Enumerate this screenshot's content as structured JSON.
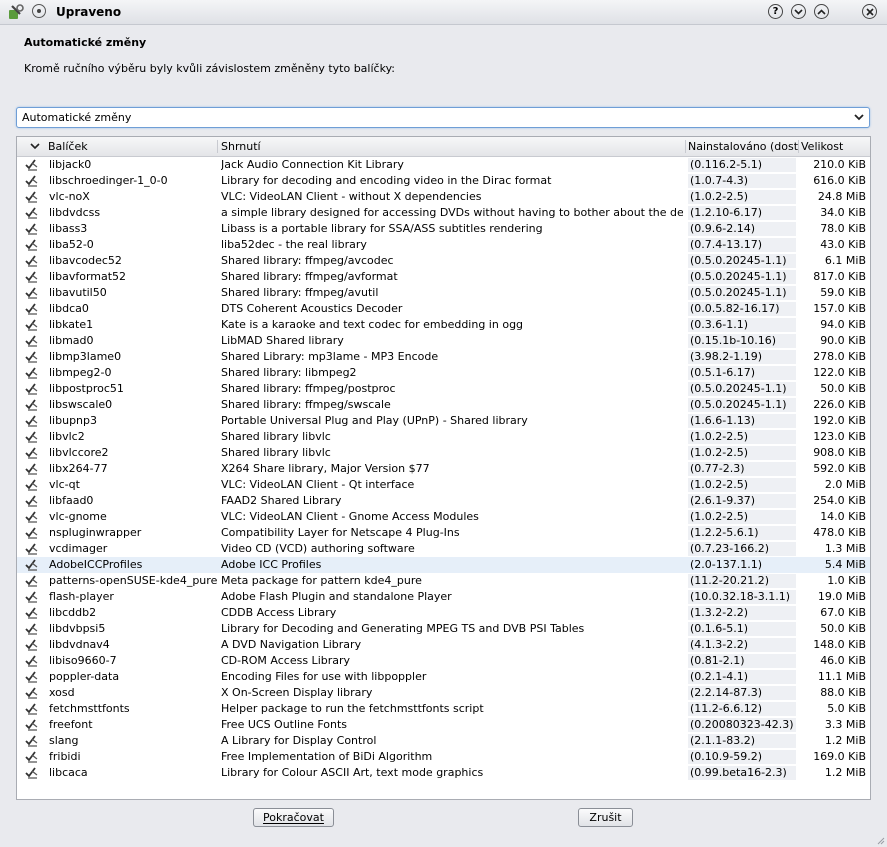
{
  "window": {
    "title": "Upraveno",
    "help_label": "?",
    "minimize_label": "⌄",
    "maximize_label": "⌃",
    "close_label": "✕"
  },
  "dialog": {
    "heading": "Automatické změny",
    "description": "Kromě ručního výběru byly kvůli závislostem změněny tyto balíčky:",
    "filter_selected": "Automatické změny"
  },
  "table": {
    "columns": [
      "Balíček",
      "Shrnutí",
      "Nainstalováno (dostup",
      "Velikost"
    ],
    "rows": [
      {
        "name": "libjack0",
        "summary": "Jack Audio Connection Kit Library",
        "installed": "(0.116.2-5.1)",
        "size": "210.0 KiB"
      },
      {
        "name": "libschroedinger-1_0-0",
        "summary": "Library for decoding and encoding video in the Dirac format",
        "installed": "(1.0.7-4.3)",
        "size": "616.0 KiB"
      },
      {
        "name": "vlc-noX",
        "summary": "VLC: VideoLAN Client - without X dependencies",
        "installed": "(1.0.2-2.5)",
        "size": "24.8 MiB"
      },
      {
        "name": "libdvdcss",
        "summary": "a simple library designed for accessing DVDs without having to bother about the decryption.",
        "installed": "(1.2.10-6.17)",
        "size": "34.0 KiB"
      },
      {
        "name": "libass3",
        "summary": "Libass is a portable library for SSA/ASS subtitles rendering",
        "installed": "(0.9.6-2.14)",
        "size": "78.0 KiB"
      },
      {
        "name": "liba52-0",
        "summary": "liba52dec - the real library",
        "installed": "(0.7.4-13.17)",
        "size": "43.0 KiB"
      },
      {
        "name": "libavcodec52",
        "summary": "Shared library: ffmpeg/avcodec",
        "installed": "(0.5.0.20245-1.1)",
        "size": "6.1 MiB"
      },
      {
        "name": "libavformat52",
        "summary": "Shared library: ffmpeg/avformat",
        "installed": "(0.5.0.20245-1.1)",
        "size": "817.0 KiB"
      },
      {
        "name": "libavutil50",
        "summary": "Shared library: ffmpeg/avutil",
        "installed": "(0.5.0.20245-1.1)",
        "size": "59.0 KiB"
      },
      {
        "name": "libdca0",
        "summary": "DTS Coherent Acoustics Decoder",
        "installed": "(0.0.5.82-16.17)",
        "size": "157.0 KiB"
      },
      {
        "name": "libkate1",
        "summary": "Kate is a karaoke and text codec for embedding in ogg",
        "installed": "(0.3.6-1.1)",
        "size": "94.0 KiB"
      },
      {
        "name": "libmad0",
        "summary": "LibMAD Shared library",
        "installed": "(0.15.1b-10.16)",
        "size": "90.0 KiB"
      },
      {
        "name": "libmp3lame0",
        "summary": "Shared Library: mp3lame - MP3 Encode",
        "installed": "(3.98.2-1.19)",
        "size": "278.0 KiB"
      },
      {
        "name": "libmpeg2-0",
        "summary": "Shared library: libmpeg2",
        "installed": "(0.5.1-6.17)",
        "size": "122.0 KiB"
      },
      {
        "name": "libpostproc51",
        "summary": "Shared library: ffmpeg/postproc",
        "installed": "(0.5.0.20245-1.1)",
        "size": "50.0 KiB"
      },
      {
        "name": "libswscale0",
        "summary": "Shared library: ffmpeg/swscale",
        "installed": "(0.5.0.20245-1.1)",
        "size": "226.0 KiB"
      },
      {
        "name": "libupnp3",
        "summary": "Portable Universal Plug and Play (UPnP) - Shared library",
        "installed": "(1.6.6-1.13)",
        "size": "192.0 KiB"
      },
      {
        "name": "libvlc2",
        "summary": "Shared library libvlc",
        "installed": "(1.0.2-2.5)",
        "size": "123.0 KiB"
      },
      {
        "name": "libvlccore2",
        "summary": "Shared library libvlc",
        "installed": "(1.0.2-2.5)",
        "size": "908.0 KiB"
      },
      {
        "name": "libx264-77",
        "summary": "X264 Share library, Major Version $77",
        "installed": "(0.77-2.3)",
        "size": "592.0 KiB"
      },
      {
        "name": "vlc-qt",
        "summary": "VLC: VideoLAN Client - Qt interface",
        "installed": "(1.0.2-2.5)",
        "size": "2.0 MiB"
      },
      {
        "name": "libfaad0",
        "summary": "FAAD2 Shared Library",
        "installed": "(2.6.1-9.37)",
        "size": "254.0 KiB"
      },
      {
        "name": "vlc-gnome",
        "summary": "VLC: VideoLAN Client - Gnome Access Modules",
        "installed": "(1.0.2-2.5)",
        "size": "14.0 KiB"
      },
      {
        "name": "nspluginwrapper",
        "summary": "Compatibility Layer for Netscape 4 Plug-Ins",
        "installed": "(1.2.2-5.6.1)",
        "size": "478.0 KiB"
      },
      {
        "name": "vcdimager",
        "summary": "Video CD (VCD) authoring software",
        "installed": "(0.7.23-166.2)",
        "size": "1.3 MiB"
      },
      {
        "name": "AdobeICCProfiles",
        "summary": "Adobe ICC Profiles",
        "installed": "(2.0-137.1.1)",
        "size": "5.4 MiB",
        "selected": true
      },
      {
        "name": "patterns-openSUSE-kde4_pure",
        "summary": "Meta package for pattern kde4_pure",
        "installed": "(11.2-20.21.2)",
        "size": "1.0 KiB"
      },
      {
        "name": "flash-player",
        "summary": "Adobe Flash Plugin and standalone Player",
        "installed": "(10.0.32.18-3.1.1)",
        "size": "19.0 MiB"
      },
      {
        "name": "libcddb2",
        "summary": "CDDB Access Library",
        "installed": "(1.3.2-2.2)",
        "size": "67.0 KiB"
      },
      {
        "name": "libdvbpsi5",
        "summary": "Library for Decoding and Generating MPEG TS and DVB PSI Tables",
        "installed": "(0.1.6-5.1)",
        "size": "50.0 KiB"
      },
      {
        "name": "libdvdnav4",
        "summary": "A DVD Navigation Library",
        "installed": "(4.1.3-2.2)",
        "size": "148.0 KiB"
      },
      {
        "name": "libiso9660-7",
        "summary": "CD-ROM Access Library",
        "installed": "(0.81-2.1)",
        "size": "46.0 KiB"
      },
      {
        "name": "poppler-data",
        "summary": "Encoding Files for use with libpoppler",
        "installed": "(0.2.1-4.1)",
        "size": "11.1 MiB"
      },
      {
        "name": "xosd",
        "summary": "X On-Screen Display library",
        "installed": "(2.2.14-87.3)",
        "size": "88.0 KiB"
      },
      {
        "name": "fetchmsttfonts",
        "summary": "Helper package to run the fetchmsttfonts script",
        "installed": "(11.2-6.6.12)",
        "size": "5.0 KiB"
      },
      {
        "name": "freefont",
        "summary": "Free UCS Outline Fonts",
        "installed": "(0.20080323-42.3)",
        "size": "3.3 MiB"
      },
      {
        "name": "slang",
        "summary": "A Library for Display Control",
        "installed": "(2.1.1-83.2)",
        "size": "1.2 MiB"
      },
      {
        "name": "fribidi",
        "summary": "Free Implementation of BiDi Algorithm",
        "installed": "(0.10.9-59.2)",
        "size": "169.0 KiB"
      },
      {
        "name": "libcaca",
        "summary": "Library for Colour ASCII Art, text mode graphics",
        "installed": "(0.99.beta16-2.3)",
        "size": "1.2 MiB"
      }
    ]
  },
  "buttons": {
    "continue_label": "Pokračovat",
    "cancel_label": "Zrušit"
  },
  "icons": {
    "app": "yast-software-icon",
    "row_status": "install-check-icon"
  },
  "colors": {
    "focus_border": "#6f9ed6",
    "selected_row": "#e6eff9"
  }
}
